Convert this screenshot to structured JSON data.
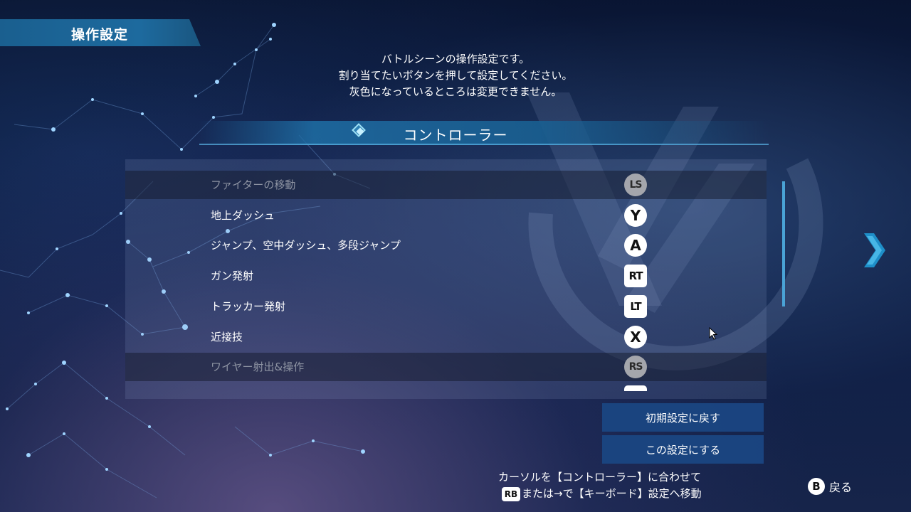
{
  "header": {
    "title": "操作設定"
  },
  "instructions": [
    "バトルシーンの操作設定です。",
    "割り当てたいボタンを押して設定してください。",
    "灰色になっているところは変更できません。"
  ],
  "section": {
    "title": "コントローラー"
  },
  "bindings": [
    {
      "label": "ファイターの移動",
      "button": "LS",
      "style": "stick",
      "disabled": true
    },
    {
      "label": "地上ダッシュ",
      "button": "Y",
      "style": "circle",
      "disabled": false
    },
    {
      "label": "ジャンプ、空中ダッシュ、多段ジャンプ",
      "button": "A",
      "style": "circle",
      "disabled": false
    },
    {
      "label": "ガン発射",
      "button": "RT",
      "style": "rect",
      "disabled": false
    },
    {
      "label": "トラッカー発射",
      "button": "LT",
      "style": "rect",
      "disabled": false
    },
    {
      "label": "近接技",
      "button": "X",
      "style": "circle",
      "disabled": false
    },
    {
      "label": "ワイヤー射出&操作",
      "button": "RS",
      "style": "stick",
      "disabled": true
    }
  ],
  "actions": {
    "reset_label": "初期設定に戻す",
    "apply_label": "この設定にする"
  },
  "hint": {
    "line1": "カーソルを【コントローラー】に合わせて",
    "rb_glyph": "RB",
    "line2": "または→で【キーボード】設定へ移動"
  },
  "back": {
    "glyph": "B",
    "label": "戻る"
  },
  "colors": {
    "accent": "#1d6a9e",
    "button_bg": "#1a4682",
    "scrollbar": "#4aa3d6",
    "disabled_text": "#8d93a2"
  }
}
